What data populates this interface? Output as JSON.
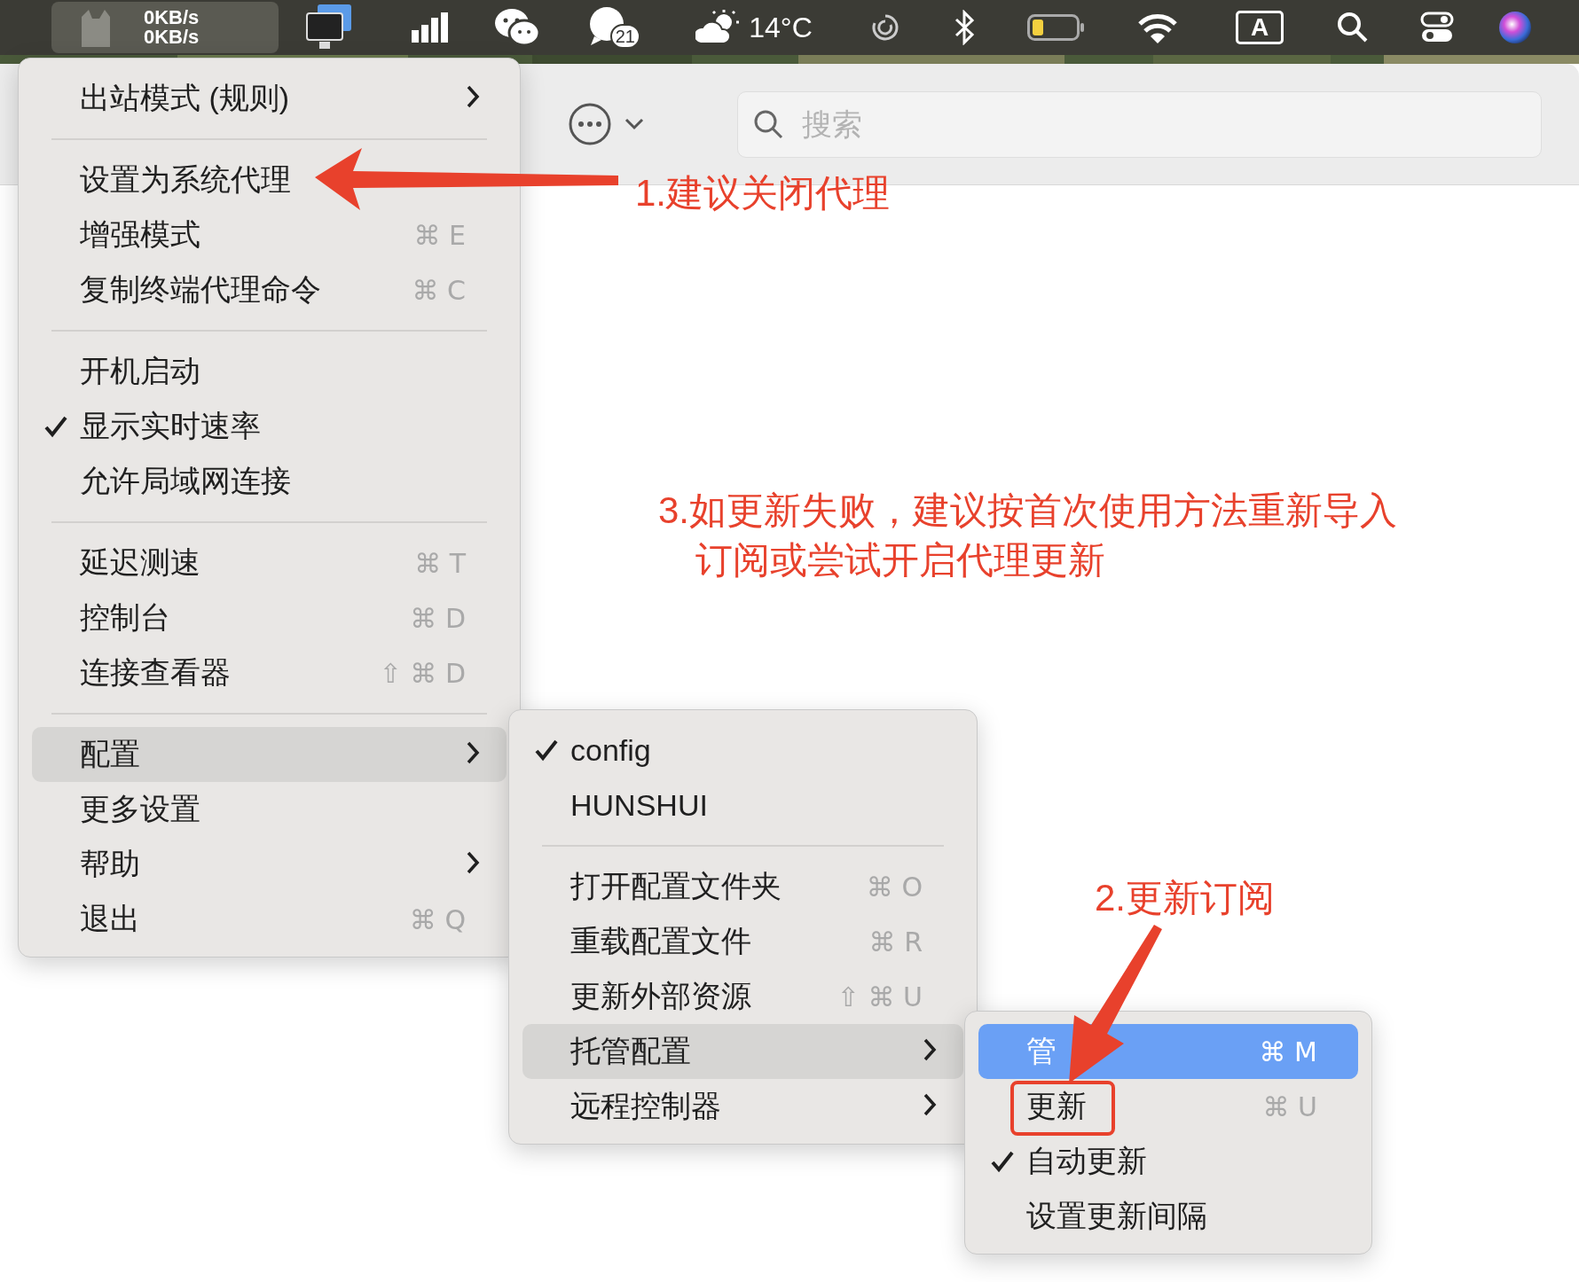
{
  "menu_bar": {
    "speed": [
      "0KB/s",
      "0KB/s"
    ],
    "badge": "21",
    "weather": "14°C",
    "input_source": "A"
  },
  "toolbar": {
    "search": {
      "placeholder": "搜索"
    }
  },
  "menus": [
    {
      "focused": false,
      "items": [
        {
          "kind": "item",
          "label": "出站模式 (规则)",
          "checked": false,
          "has_submenu": true,
          "selected": false
        },
        {
          "kind": "separator"
        },
        {
          "kind": "item",
          "label": "设置为系统代理",
          "checked": false,
          "has_submenu": false,
          "selected": false
        },
        {
          "kind": "item",
          "label": "增强模式",
          "shortcut": "⌘ E",
          "checked": false,
          "has_submenu": false,
          "selected": false
        },
        {
          "kind": "item",
          "label": "复制终端代理命令",
          "shortcut": "⌘ C",
          "checked": false,
          "has_submenu": false,
          "selected": false
        },
        {
          "kind": "separator"
        },
        {
          "kind": "item",
          "label": "开机启动",
          "checked": false,
          "has_submenu": false,
          "selected": false
        },
        {
          "kind": "item",
          "label": "显示实时速率",
          "checked": true,
          "has_submenu": false,
          "selected": false
        },
        {
          "kind": "item",
          "label": "允许局域网连接",
          "checked": false,
          "has_submenu": false,
          "selected": false
        },
        {
          "kind": "separator"
        },
        {
          "kind": "item",
          "label": "延迟测速",
          "shortcut": "⌘ T",
          "checked": false,
          "has_submenu": false,
          "selected": false
        },
        {
          "kind": "item",
          "label": "控制台",
          "shortcut": "⌘ D",
          "checked": false,
          "has_submenu": false,
          "selected": false
        },
        {
          "kind": "item",
          "label": "连接查看器",
          "shortcut": "⇧ ⌘ D",
          "checked": false,
          "has_submenu": false,
          "selected": false
        },
        {
          "kind": "separator"
        },
        {
          "kind": "item",
          "label": "配置",
          "checked": false,
          "has_submenu": true,
          "selected": true
        },
        {
          "kind": "item",
          "label": "更多设置",
          "checked": false,
          "has_submenu": false,
          "selected": false
        },
        {
          "kind": "item",
          "label": "帮助",
          "checked": false,
          "has_submenu": true,
          "selected": false
        },
        {
          "kind": "item",
          "label": "退出",
          "shortcut": "⌘ Q",
          "checked": false,
          "has_submenu": false,
          "selected": false
        }
      ]
    },
    {
      "focused": false,
      "items": [
        {
          "kind": "item",
          "label": "config",
          "checked": true,
          "has_submenu": false,
          "selected": false
        },
        {
          "kind": "item",
          "label": "HUNSHUI",
          "checked": false,
          "has_submenu": false,
          "selected": false
        },
        {
          "kind": "separator"
        },
        {
          "kind": "item",
          "label": "打开配置文件夹",
          "shortcut": "⌘ O",
          "checked": false,
          "has_submenu": false,
          "selected": false
        },
        {
          "kind": "item",
          "label": "重载配置文件",
          "shortcut": "⌘ R",
          "checked": false,
          "has_submenu": false,
          "selected": false
        },
        {
          "kind": "item",
          "label": "更新外部资源",
          "shortcut": "⇧ ⌘ U",
          "checked": false,
          "has_submenu": false,
          "selected": false
        },
        {
          "kind": "item",
          "label": "托管配置",
          "checked": false,
          "has_submenu": true,
          "selected": true
        },
        {
          "kind": "item",
          "label": "远程控制器",
          "checked": false,
          "has_submenu": true,
          "selected": false
        }
      ]
    },
    {
      "focused": true,
      "items": [
        {
          "kind": "item",
          "label": "管",
          "shortcut": "⌘ M",
          "checked": false,
          "has_submenu": false,
          "selected": true,
          "outlined": false
        },
        {
          "kind": "item",
          "label": "更新",
          "shortcut": "⌘ U",
          "checked": false,
          "has_submenu": false,
          "selected": false,
          "outlined": true
        },
        {
          "kind": "item",
          "label": "自动更新",
          "checked": true,
          "has_submenu": false,
          "selected": false,
          "outlined": false
        },
        {
          "kind": "item",
          "label": "设置更新间隔",
          "checked": false,
          "has_submenu": false,
          "selected": false,
          "outlined": false
        }
      ]
    }
  ],
  "annotations": [
    {
      "lines": [
        "1.建议关闭代理"
      ]
    },
    {
      "lines": [
        "3.如更新失败，建议按首次使用方法重新导入",
        "订阅或尝试开启代理更新"
      ]
    },
    {
      "lines": [
        "2.更新订阅"
      ]
    }
  ]
}
